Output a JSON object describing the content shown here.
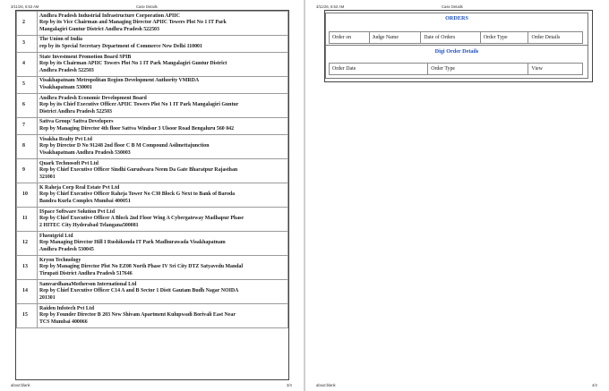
{
  "left_page": {
    "header_datetime": "3/11/26, 6:53 AM",
    "header_title": "Case Details",
    "footer_url": "about:blank",
    "footer_page": "3/4",
    "respondents": [
      {
        "no": "2",
        "lines": [
          "Andhra Pradesh Industrial Infrastructure Corporation APIIC",
          "Rep by its Vice Chairman and Managing Director APIIC Towers Plot No 1 IT Park",
          "Mangalagiri Guntur District Andhra Pradesh 522503"
        ]
      },
      {
        "no": "3",
        "lines": [
          "The Union of India",
          "rep by its Special Secretary Department of Commerce New Delhi 110001"
        ]
      },
      {
        "no": "4",
        "lines": [
          "State Investment Promotion Board SPIB",
          "Rep by its Chairman APIIC Towers Plot No 1 IT Park Mangalagiri Guntur District",
          "Andhra Pradesh 522503"
        ]
      },
      {
        "no": "5",
        "lines": [
          "Visakhapatnam Metropolitan Region Development Authority VMRDA",
          "Visakhapatnam 530001"
        ]
      },
      {
        "no": "6",
        "lines": [
          "Andhra Pradesh Economic Development Board",
          "Rep by its Chief Executive Officer APIIC Towers Plot No 1 IT Park Mangalagiri Guntur",
          "District Andhra Pradesh 522503"
        ]
      },
      {
        "no": "7",
        "lines": [
          "Sattva Group/ Sattva Developers",
          "Rep by Managing Director 4th floor Sattva Windsor 3 Ulsoor Road Bengaluru 560 042"
        ]
      },
      {
        "no": "8",
        "lines": [
          "Visakha Realty Pvt Ltd",
          "Rep by Director D No 91248 2nd floor C B M Compound Asilmettajunction",
          "Visakhapatnam Andhra Pradesh 530003"
        ]
      },
      {
        "no": "9",
        "lines": [
          "Quark Technosoft Pvt Ltd",
          "Rep by Chief Executive Officer Sindhi Gurudwara Neem Da Gate Bharatpur Rajasthan",
          "321001"
        ]
      },
      {
        "no": "10",
        "lines": [
          "K Raheja Corp Real Estate Pvt Ltd",
          "Rep by Chief Executive Officer Raheja Tower No C30 Block G Next to Bank of Baroda",
          "Bandra Kurla Complex Mumbai 400051"
        ]
      },
      {
        "no": "11",
        "lines": [
          "ISpace Software Solution Pvt Ltd",
          "Rep by Chief Executive Officer A Block 2nd Floor Wing A Cybergateway Madhapur Phase",
          "2 HITEC City Hyderabad Telangana500081"
        ]
      },
      {
        "no": "12",
        "lines": [
          "Fluentgrid Ltd",
          "Rep Managing Director Hill I Rushikonda IT Park Madhurawada Visakhapatnam",
          "Andhra Pradesh 530045"
        ]
      },
      {
        "no": "13",
        "lines": [
          "Kryon Technology",
          "Rep by Managing Director Plot No EZ08 North Phase IV Sri City DTZ Satyavedu Mandal",
          "Tirupati District Andhra Pradesh 517646"
        ]
      },
      {
        "no": "14",
        "lines": [
          "SamvardhanaMotherson International Ltd",
          "Rep by Chief Executive Officer C14 A and B Sector 1 Distt Gautam Budh Nagar NOIDA",
          "201301"
        ]
      },
      {
        "no": "15",
        "lines": [
          "Raiden Infotech Pvt Ltd",
          "Rep by Founder Director B 203 New Shivam Apartment Kulupwadi Borivali East Near",
          "TCS Mumbai 400066"
        ]
      }
    ]
  },
  "right_page": {
    "header_datetime": "3/11/26, 6:53 AM",
    "header_title": "Case Details",
    "footer_url": "about:blank",
    "footer_page": "4/4",
    "orders": {
      "title": "ORDERS",
      "columns": [
        "Order on",
        "Judge Name",
        "Date of Orders",
        "Order Type",
        "Order Details"
      ]
    },
    "digi_orders": {
      "title": "Digi Order Details",
      "columns": [
        "Order Date",
        "Order Type",
        "View"
      ]
    }
  },
  "colors": {
    "section_title": "#1e50c8",
    "border": "#888888"
  }
}
